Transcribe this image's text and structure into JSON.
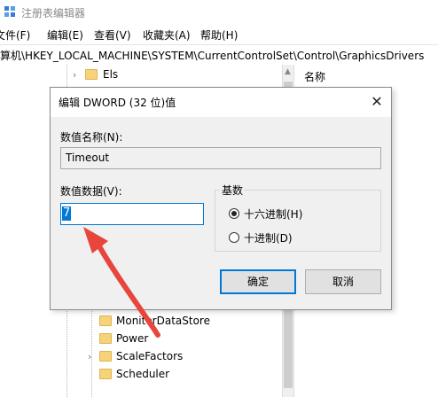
{
  "window": {
    "title": "注册表编辑器",
    "menu": [
      "文件(F)",
      "编辑(E)",
      "查看(V)",
      "收藏夹(A)",
      "帮助(H)"
    ],
    "address": "计算机\\HKEY_LOCAL_MACHINE\\SYSTEM\\CurrentControlSet\\Control\\GraphicsDrivers"
  },
  "tree": {
    "items": [
      {
        "label": "Els",
        "expandable": true
      },
      {
        "label": "MonitorDataStore",
        "expandable": false
      },
      {
        "label": "Power",
        "expandable": false
      },
      {
        "label": "ScaleFactors",
        "expandable": true
      },
      {
        "label": "Scheduler",
        "expandable": false
      }
    ]
  },
  "right_pane": {
    "column_name": "名称"
  },
  "dialog": {
    "title": "编辑 DWORD (32 位)值",
    "close_glyph": "✕",
    "name_label": "数值名称(N):",
    "name_value": "Timeout",
    "data_label": "数值数据(V):",
    "data_value": "7",
    "base_legend": "基数",
    "hex_label": "十六进制(H)",
    "dec_label": "十进制(D)",
    "selected_base": "hex",
    "ok_label": "确定",
    "cancel_label": "取消"
  },
  "colors": {
    "accent": "#0078d7",
    "annotation_arrow": "#e8453c"
  }
}
